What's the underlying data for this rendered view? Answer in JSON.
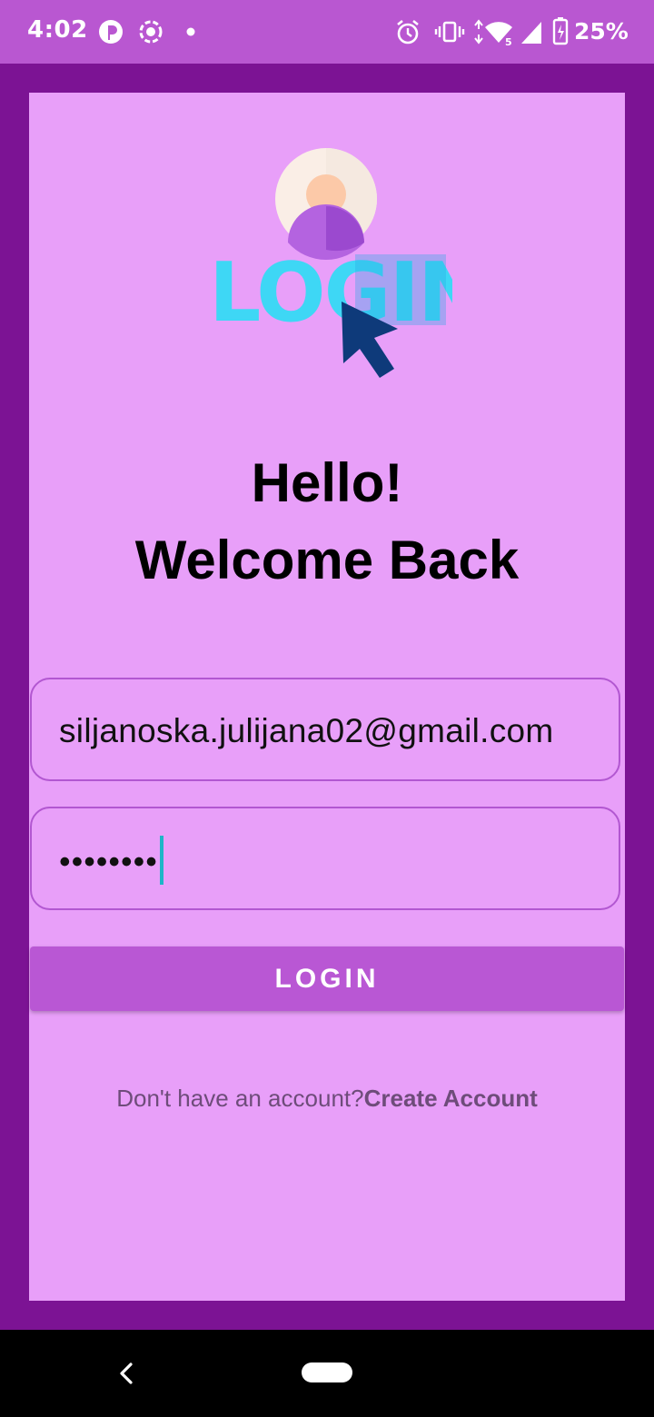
{
  "status_bar": {
    "time": "4:02",
    "battery_percent": "25%",
    "left_icons": [
      "pinterest-icon",
      "screen-record-icon",
      "notification-dot-icon"
    ],
    "right_icons": [
      "alarm-icon",
      "vibrate-icon",
      "wifi-icon",
      "signal-icon",
      "battery-charging-icon"
    ]
  },
  "login": {
    "logo_text": "LOGIN",
    "greeting_line1": "Hello!",
    "greeting_line2": "Welcome Back",
    "email_value": "siljanoska.julijana02@gmail.com",
    "password_value": "••••••••",
    "login_button_label": "LOGIN",
    "no_account_text": "Don't have an account?",
    "create_account_link": "Create Account"
  },
  "colors": {
    "status_bar": "#b957d1",
    "outer_background": "#7c1394",
    "panel_background": "#e89ff9",
    "field_border": "#b257d1",
    "button": "#b957d4",
    "caret": "#1db5c7",
    "logo_cyan": "#3ed7f5",
    "logo_blue": "#2aa8e6",
    "cursor_navy": "#0e3a7a"
  },
  "nav_bar": {
    "icons": [
      "back-icon",
      "home-pill-icon"
    ]
  }
}
